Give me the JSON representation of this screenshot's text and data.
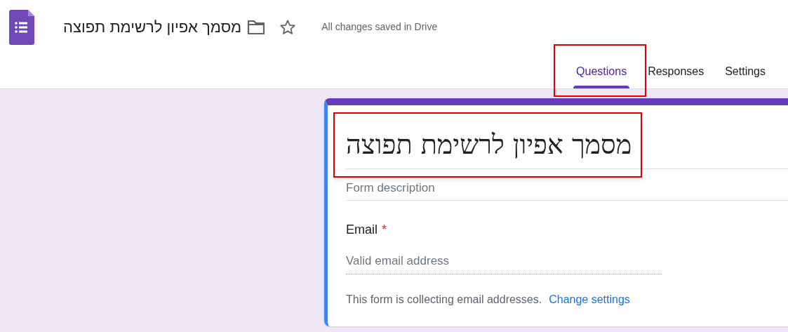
{
  "header": {
    "title": "מסמך אפיון לרשימת תפוצה",
    "save_status": "All changes saved in Drive"
  },
  "tabs": [
    {
      "label": "Questions",
      "selected": true,
      "highlighted": true
    },
    {
      "label": "Responses",
      "selected": false,
      "highlighted": false
    },
    {
      "label": "Settings",
      "selected": false,
      "highlighted": false
    }
  ],
  "form": {
    "title": "מסמך אפיון לרשימת תפוצה",
    "title_highlighted": true,
    "description_placeholder": "Form description",
    "question": {
      "label": "Email",
      "required_mark": "*",
      "placeholder": "Valid email address"
    },
    "note": "This form is collecting email addresses.",
    "note_link": "Change settings"
  }
}
